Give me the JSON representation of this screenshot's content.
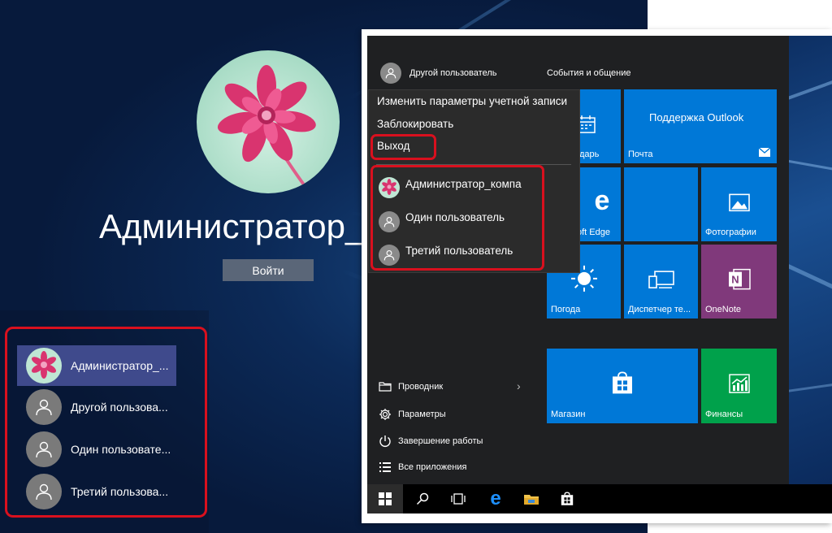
{
  "login": {
    "user_name": "Администратор_к",
    "signin_label": "Войти",
    "users": [
      {
        "label": "Администратор_...",
        "avatar": "flower",
        "selected": true
      },
      {
        "label": "Другой пользова...",
        "avatar": "person-icon"
      },
      {
        "label": "Один пользовате...",
        "avatar": "person-icon"
      },
      {
        "label": "Третий пользова...",
        "avatar": "person-icon"
      }
    ]
  },
  "start_menu": {
    "current_user": "Другой пользователь",
    "section_title": "События и общение",
    "account_menu": {
      "items": [
        "Изменить параметры учетной записи",
        "Заблокировать",
        "Выход"
      ],
      "users": [
        "Администратор_компа",
        "Один пользователь",
        "Третий пользователь"
      ]
    },
    "left_items": [
      {
        "label": "Проводник",
        "icon": "folder-icon",
        "chevron": "›"
      },
      {
        "label": "Параметры",
        "icon": "gear-icon"
      },
      {
        "label": "Завершение работы",
        "icon": "power-icon"
      },
      {
        "label": "Все приложения",
        "icon": "apps-list-icon"
      }
    ],
    "tiles": {
      "calendar": "дарь",
      "outlook_title": "Поддержка Outlook",
      "mail": "Почта",
      "edge": "oft Edge",
      "photos": "Фотографии",
      "weather": "Погода",
      "devices": "Диспетчер те...",
      "onenote": "OneNote",
      "store": "Магазин",
      "finance": "Финансы"
    },
    "colors": {
      "tile_blue": "#0078d7",
      "tile_purple": "#80397b",
      "tile_green": "#00a14b",
      "highlight": "#d9101e"
    }
  },
  "taskbar": {
    "icons": [
      "windows-start-icon",
      "search-icon",
      "task-view-icon",
      "edge-icon",
      "file-explorer-icon",
      "store-icon"
    ]
  }
}
